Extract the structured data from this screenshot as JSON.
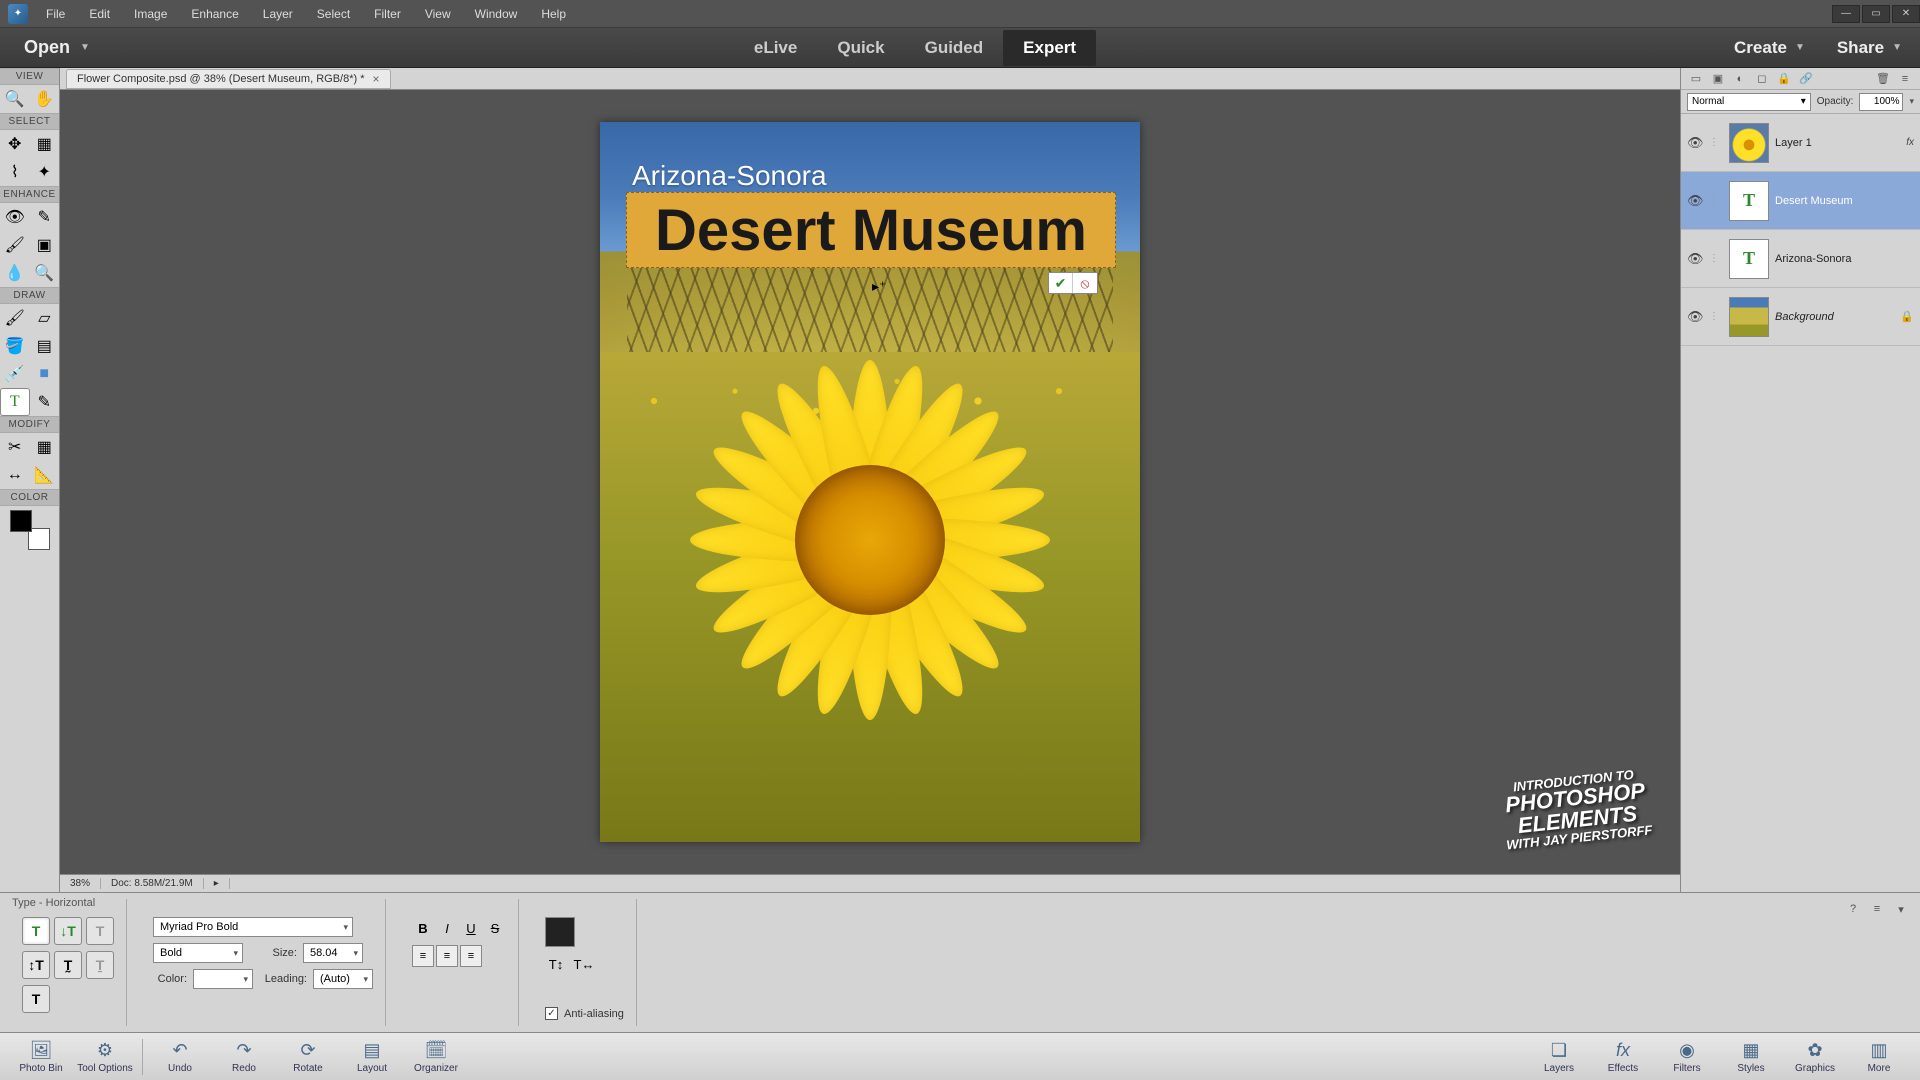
{
  "menu": [
    "File",
    "Edit",
    "Image",
    "Enhance",
    "Layer",
    "Select",
    "Filter",
    "View",
    "Window",
    "Help"
  ],
  "modebar": {
    "open": "Open",
    "tabs": [
      "eLive",
      "Quick",
      "Guided",
      "Expert"
    ],
    "active_tab": "Expert",
    "create": "Create",
    "share": "Share"
  },
  "toolbox": {
    "sections": [
      "VIEW",
      "SELECT",
      "ENHANCE",
      "DRAW",
      "MODIFY",
      "COLOR"
    ]
  },
  "document": {
    "tab_title": "Flower Composite.psd @ 38% (Desert Museum, RGB/8*) *",
    "zoom": "38%",
    "doc_size": "Doc: 8.58M/21.9M",
    "text_az": "Arizona-Sonora",
    "text_dm": "Desert Museum"
  },
  "watermark": {
    "l1": "INTRODUCTION TO",
    "l2": "PHOTOSHOP",
    "l3": "ELEMENTS",
    "l4": "WITH JAY PIERSTORFF"
  },
  "layers_panel": {
    "blend_mode": "Normal",
    "opacity_label": "Opacity:",
    "opacity_value": "100%",
    "layers": [
      {
        "name": "Layer 1",
        "type": "image",
        "fx": true
      },
      {
        "name": "Desert Museum",
        "type": "text",
        "selected": true
      },
      {
        "name": "Arizona-Sonora",
        "type": "text"
      },
      {
        "name": "Background",
        "type": "image",
        "locked": true,
        "italic": true
      }
    ]
  },
  "options": {
    "title": "Type - Horizontal",
    "font": "Myriad Pro Bold",
    "weight": "Bold",
    "size_label": "Size:",
    "size": "58.04",
    "color_label": "Color:",
    "leading_label": "Leading:",
    "leading": "(Auto)",
    "anti_alias": "Anti-aliasing"
  },
  "bottom": {
    "left": [
      "Photo Bin",
      "Tool Options",
      "Undo",
      "Redo",
      "Rotate",
      "Layout",
      "Organizer"
    ],
    "right": [
      "Layers",
      "Effects",
      "Filters",
      "Styles",
      "Graphics",
      "More"
    ]
  }
}
